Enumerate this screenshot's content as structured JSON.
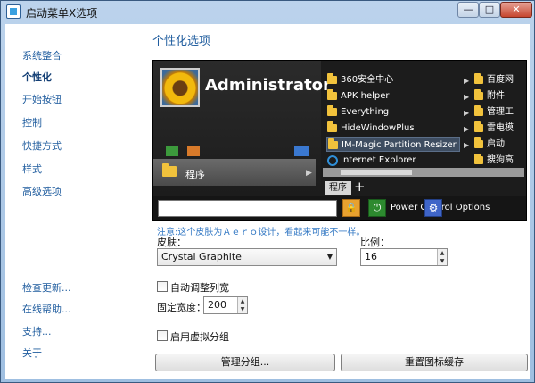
{
  "window": {
    "title": "启动菜单X选项"
  },
  "titlebar": {
    "minimize": "—",
    "maximize": "□",
    "close": "✕"
  },
  "nav": {
    "items": [
      {
        "label": "系统整合",
        "active": false
      },
      {
        "label": "个性化",
        "active": true
      },
      {
        "label": "开始按钮",
        "active": false
      },
      {
        "label": "控制",
        "active": false
      },
      {
        "label": "快捷方式",
        "active": false
      },
      {
        "label": "样式",
        "active": false
      },
      {
        "label": "高级选项",
        "active": false
      }
    ],
    "bottom_items": [
      {
        "label": "检查更新..."
      },
      {
        "label": "在线帮助..."
      },
      {
        "label": "支持..."
      },
      {
        "label": "关于"
      }
    ]
  },
  "main": {
    "title": "个性化选项",
    "preview": {
      "user_name": "Administrator",
      "programs_label": "程序",
      "list_items": [
        {
          "label": "360安全中心",
          "icon": "folder"
        },
        {
          "label": "APK helper",
          "icon": "folder"
        },
        {
          "label": "Everything",
          "icon": "folder"
        },
        {
          "label": "HideWindowPlus",
          "icon": "folder"
        },
        {
          "label": "IM-Magic Partition Resizer S",
          "icon": "folder",
          "highlighted": true
        },
        {
          "label": "Internet Explorer",
          "icon": "ie"
        }
      ],
      "sub_items": [
        {
          "label": "百度网"
        },
        {
          "label": "附件"
        },
        {
          "label": "管理工"
        },
        {
          "label": "雷电模"
        },
        {
          "label": "启动"
        },
        {
          "label": "搜狗高"
        }
      ],
      "tab_label": "程序",
      "add_tab": "+",
      "power_text": "Power Control Options",
      "lock_glyph": "🔒",
      "power_glyph": "⏻",
      "gear_glyph": "⚙"
    },
    "note": "注意:这个皮肤为Ａｅｒｏ设计，看起来可能不一样。",
    "skin": {
      "label": "皮肤：",
      "value": "Crystal Graphite",
      "arrow": "▼"
    },
    "scale": {
      "label": "比例：",
      "value": "16"
    },
    "auto_width": {
      "label": "自动调整列宽",
      "checked": false
    },
    "fixed_width": {
      "label": "固定宽度：",
      "value": "200"
    },
    "virtual_groups": {
      "label": "启用虚拟分组",
      "checked": false
    },
    "buttons": {
      "manage_groups": "管理分组...",
      "reset_icon_cache": "重置图标缓存"
    },
    "colors": {
      "accent": "#1f5c9e",
      "note": "#3479c4",
      "preview_bg": "#1c1c1c"
    }
  }
}
